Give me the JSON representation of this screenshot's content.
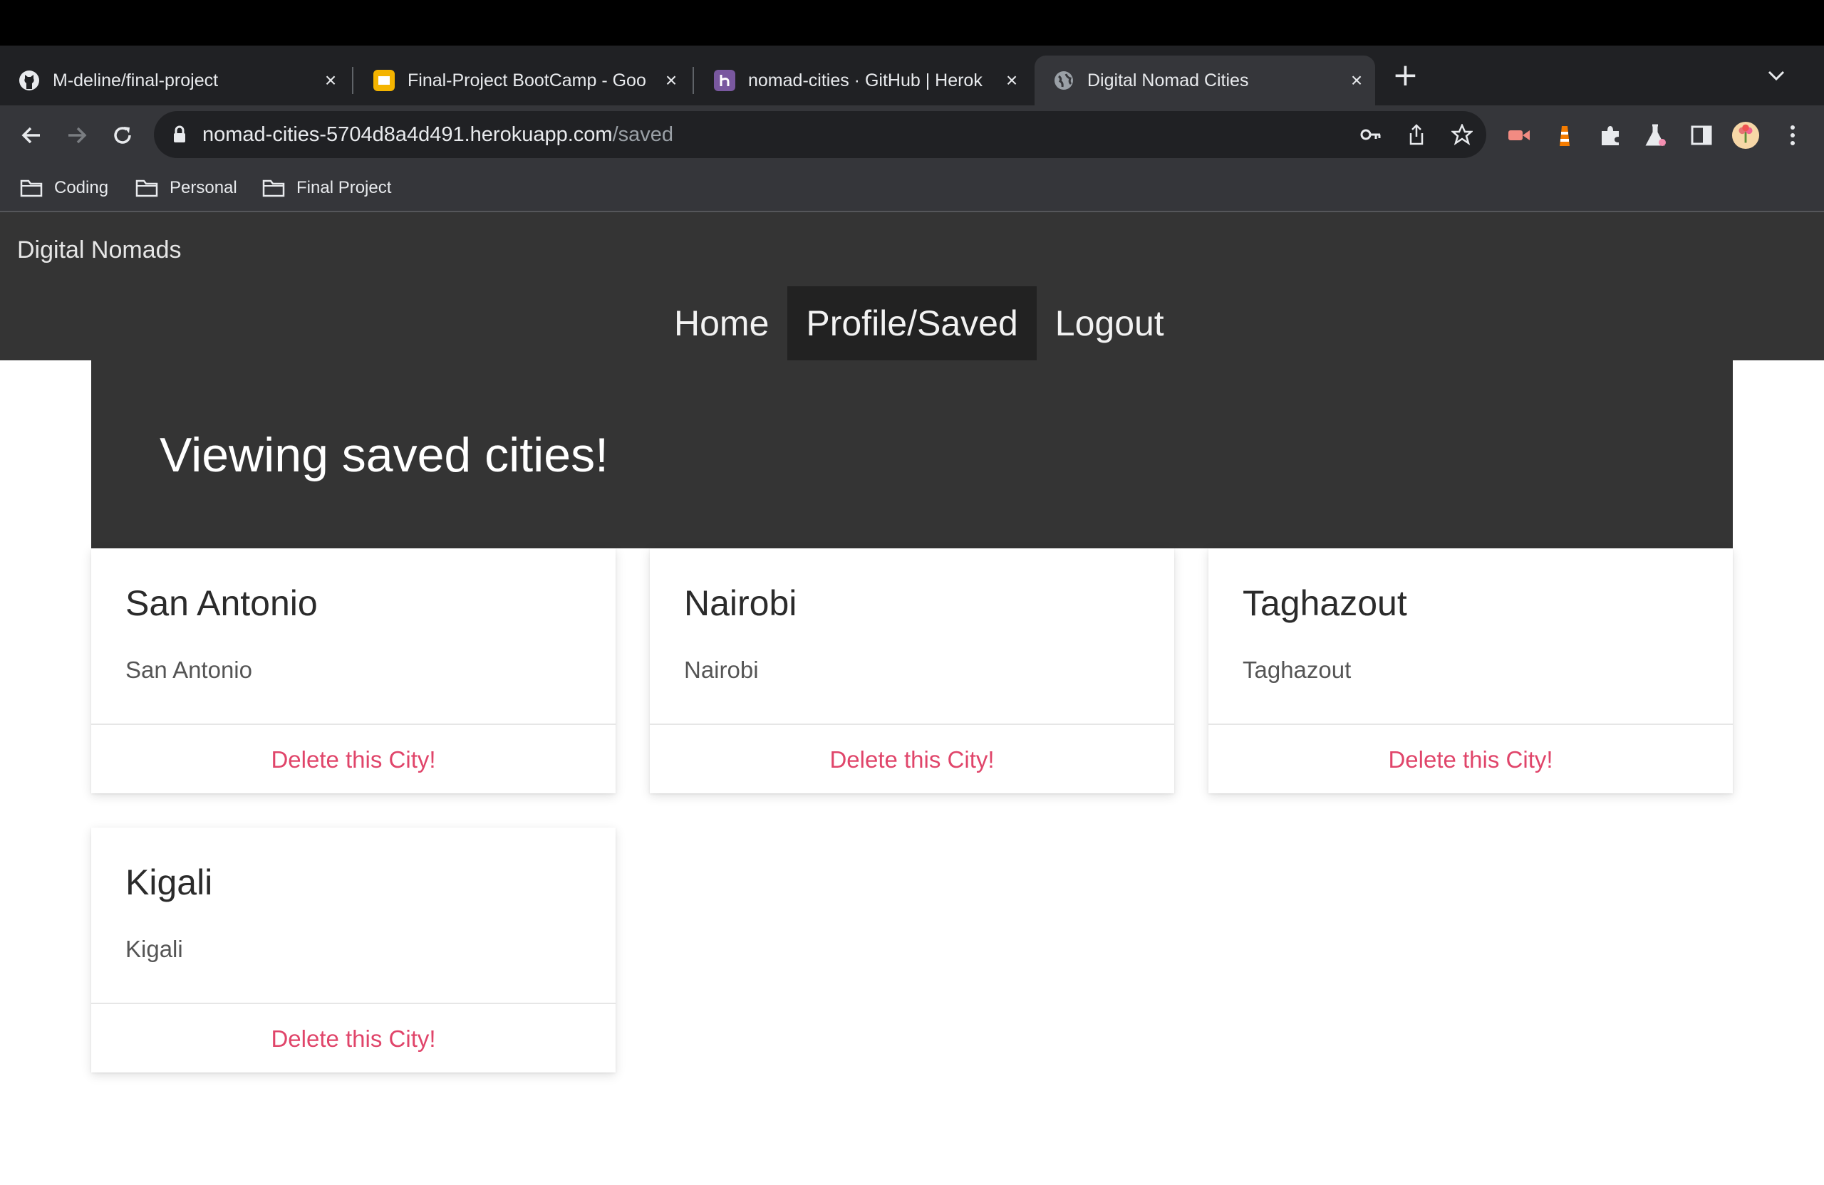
{
  "browser": {
    "tabs": [
      {
        "title": "M-deline/final-project",
        "icon": "github-icon"
      },
      {
        "title": "Final-Project BootCamp - Goo",
        "icon": "slides-icon"
      },
      {
        "title": "nomad-cities · GitHub | Herok",
        "icon": "heroku-icon"
      },
      {
        "title": "Digital Nomad Cities",
        "icon": "globe-icon",
        "active": true
      }
    ],
    "new_tab": "+",
    "address": {
      "host": "nomad-cities-5704d8a4d491.herokuapp.com",
      "path": "/saved"
    },
    "bookmarks": [
      "Coding",
      "Personal",
      "Final Project"
    ]
  },
  "site": {
    "brand": "Digital Nomads",
    "nav": [
      {
        "label": "Home"
      },
      {
        "label": "Profile/Saved",
        "active": true
      },
      {
        "label": "Logout"
      }
    ],
    "hero_title": "Viewing saved cities!",
    "cards": [
      {
        "title": "San Antonio",
        "text": "San Antonio",
        "action": "Delete this City!"
      },
      {
        "title": "Nairobi",
        "text": "Nairobi",
        "action": "Delete this City!"
      },
      {
        "title": "Taghazout",
        "text": "Taghazout",
        "action": "Delete this City!"
      },
      {
        "title": "Kigali",
        "text": "Kigali",
        "action": "Delete this City!"
      }
    ]
  },
  "colors": {
    "nav_bg": "#343434",
    "active_nav": "#222222",
    "delete_link": "#e0456a"
  }
}
